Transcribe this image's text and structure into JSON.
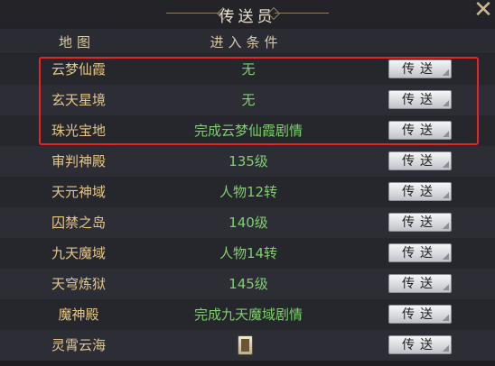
{
  "dialog": {
    "title": "传送员",
    "close_icon": "close-icon"
  },
  "header": {
    "map": "地图",
    "condition": "进入条件"
  },
  "rows": [
    {
      "map": "云梦仙霞",
      "condition": "无",
      "button": "传送"
    },
    {
      "map": "玄天星境",
      "condition": "无",
      "button": "传送"
    },
    {
      "map": "珠光宝地",
      "condition": "完成云梦仙霞剧情",
      "button": "传送"
    },
    {
      "map": "审判神殿",
      "condition": "135级",
      "button": "传送"
    },
    {
      "map": "天元神域",
      "condition": "人物12转",
      "button": "传送"
    },
    {
      "map": "囚禁之岛",
      "condition": "140级",
      "button": "传送"
    },
    {
      "map": "九天魔域",
      "condition": "人物14转",
      "button": "传送"
    },
    {
      "map": "天穹炼狱",
      "condition": "145级",
      "button": "传送"
    },
    {
      "map": "魔神殿",
      "condition": "完成九天魔域剧情",
      "button": "传送"
    },
    {
      "map": "灵霄云海",
      "condition": "",
      "condition_icon": "token-item-icon",
      "button": "传送"
    }
  ],
  "colors": {
    "map_text": "#e3c68a",
    "condition_text": "#7fcf6e",
    "highlight_border": "#e2272c"
  }
}
